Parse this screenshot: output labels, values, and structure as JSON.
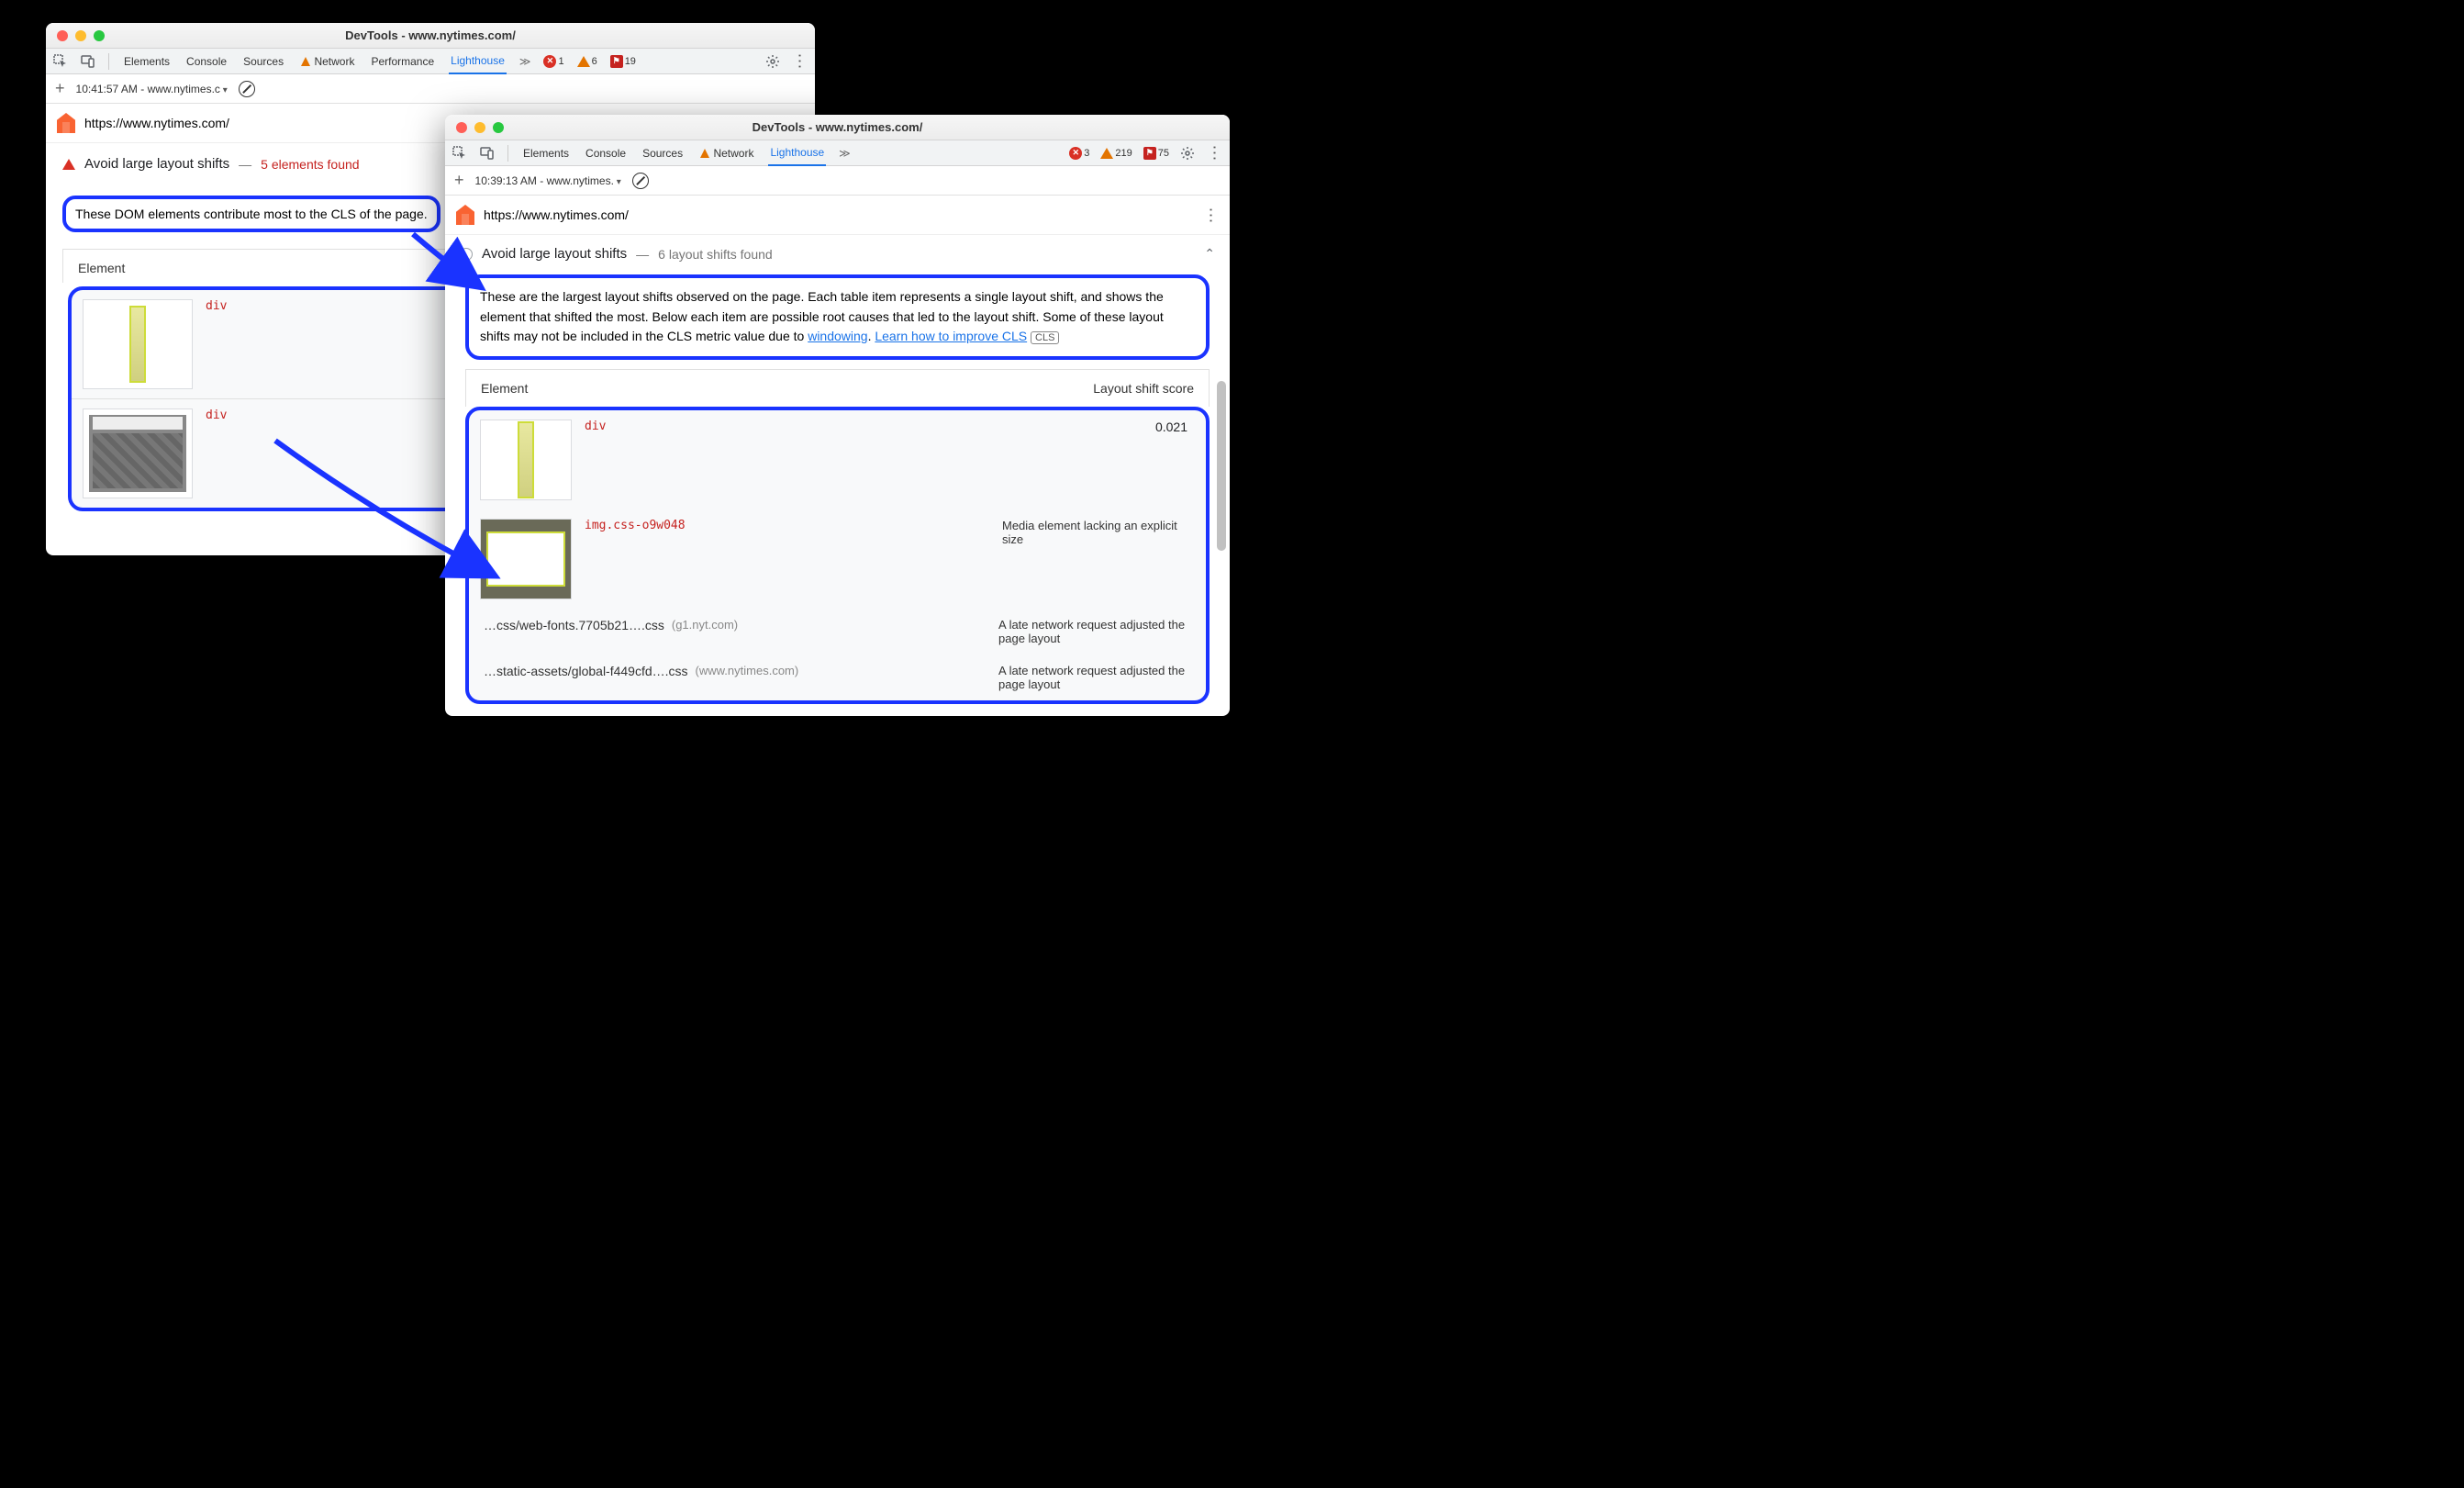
{
  "window1": {
    "title": "DevTools - www.nytimes.com/",
    "tabs": [
      "Elements",
      "Console",
      "Sources",
      "Network",
      "Performance",
      "Lighthouse"
    ],
    "activeTab": "Lighthouse",
    "stats": {
      "errors": 1,
      "warnings": 6,
      "issues": 19
    },
    "sub": {
      "time": "10:41:57 AM - www.nytimes.c"
    },
    "url": "https://www.nytimes.com/",
    "audit": {
      "title": "Avoid large layout shifts",
      "found": "5 elements found"
    },
    "desc": "These DOM elements contribute most to the CLS of the page.",
    "col": "Element",
    "rows": [
      {
        "el": "div"
      },
      {
        "el": "div"
      }
    ]
  },
  "window2": {
    "title": "DevTools - www.nytimes.com/",
    "tabs": [
      "Elements",
      "Console",
      "Sources",
      "Network",
      "Lighthouse"
    ],
    "activeTab": "Lighthouse",
    "stats": {
      "errors": 3,
      "warnings": 219,
      "issues": 75
    },
    "sub": {
      "time": "10:39:13 AM - www.nytimes."
    },
    "url": "https://www.nytimes.com/",
    "audit": {
      "title": "Avoid large layout shifts",
      "found": "6 layout shifts found"
    },
    "desc": {
      "p1": "These are the largest layout shifts observed on the page. Each table item represents a single layout shift, and shows the element that shifted the most. Below each item are possible root causes that led to the layout shift. Some of these layout shifts may not be included in the CLS metric value due to ",
      "link1": "windowing",
      "mid": ". ",
      "link2": "Learn how to improve CLS",
      "badge": "CLS"
    },
    "cols": {
      "c1": "Element",
      "c2": "Layout shift score"
    },
    "rows": [
      {
        "el": "div",
        "score": "0.021"
      },
      {
        "el": "img.css-o9w048",
        "cause": "Media element lacking an explicit size"
      }
    ],
    "resources": [
      {
        "name": "…css/web-fonts.7705b21….css",
        "host": "(g1.nyt.com)",
        "cause": "A late network request adjusted the page layout"
      },
      {
        "name": "…static-assets/global-f449cfd….css",
        "host": "(www.nytimes.com)",
        "cause": "A late network request adjusted the page layout"
      }
    ]
  }
}
